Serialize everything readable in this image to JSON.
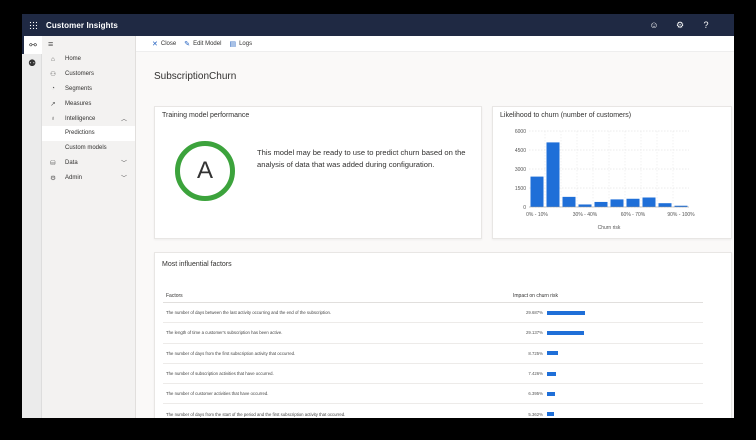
{
  "app": {
    "title": "Customer Insights"
  },
  "topbar": {
    "icons": [
      "smiley-icon",
      "gear-icon",
      "help-icon"
    ],
    "help_glyph": "?"
  },
  "rail": {
    "icons": [
      "network-icon",
      "people-icon"
    ]
  },
  "sidebar": {
    "items": [
      {
        "label": "Home",
        "icon": "home-icon"
      },
      {
        "label": "Customers",
        "icon": "customers-icon"
      },
      {
        "label": "Segments",
        "icon": "segments-icon"
      },
      {
        "label": "Measures",
        "icon": "measures-icon"
      },
      {
        "label": "Intelligence",
        "icon": "lightbulb-icon",
        "expanded": true
      },
      {
        "label": "Predictions",
        "selected": true
      },
      {
        "label": "Custom models"
      },
      {
        "label": "Data",
        "icon": "data-icon"
      },
      {
        "label": "Admin",
        "icon": "admin-icon"
      }
    ]
  },
  "commands": {
    "close": "Close",
    "edit": "Edit Model",
    "logs": "Logs"
  },
  "page": {
    "title": "SubscriptionChurn"
  },
  "training": {
    "title": "Training model performance",
    "grade": "A",
    "grade_color": "#3ca33c",
    "text": "This model may be ready to use to predict churn based on the analysis of data that was added during configuration."
  },
  "likelihood": {
    "title": "Likelihood to churn (number of customers)"
  },
  "chart_data": {
    "type": "bar",
    "title": "Likelihood to churn (number of customers)",
    "xlabel": "Churn risk",
    "ylabel": "",
    "categories": [
      "0% - 10%",
      "10% - 20%",
      "20% - 30%",
      "30% - 40%",
      "40% - 50%",
      "50% - 60%",
      "60% - 70%",
      "70% - 80%",
      "80% - 90%",
      "90% - 100%"
    ],
    "x_tick_labels": [
      "0% - 10%",
      "30% - 40%",
      "60% - 70%",
      "90% - 100%"
    ],
    "values": [
      2400,
      5100,
      800,
      200,
      400,
      600,
      650,
      750,
      300,
      100
    ],
    "yticks": [
      0,
      1500,
      3000,
      4500,
      6000
    ],
    "ytick_labels": [
      "0",
      "1500",
      "3000",
      "4500",
      "6000"
    ],
    "ylim": [
      0,
      6000
    ],
    "grid": true,
    "bar_color": "#1f6fd8"
  },
  "factors": {
    "title": "Most influential factors",
    "col_factor": "Factors",
    "col_impact": "Impact on churn risk",
    "rows": [
      {
        "factor": "The number of days between the last activity occurring and the end of the subscription.",
        "impact": "29.687%",
        "value": 29.687
      },
      {
        "factor": "The length of time a customer's subscription has been active.",
        "impact": "29.137%",
        "value": 29.137
      },
      {
        "factor": "The number of days from the first subscription activity that occurred.",
        "impact": "8.725%",
        "value": 8.725
      },
      {
        "factor": "The number of subscription activities that have occurred.",
        "impact": "7.426%",
        "value": 7.426
      },
      {
        "factor": "The number of customer activities that have occurred.",
        "impact": "6.395%",
        "value": 6.395
      },
      {
        "factor": "The number of days from the start of the period and the first subscription activity that occurred.",
        "impact": "5.362%",
        "value": 5.362
      }
    ]
  }
}
